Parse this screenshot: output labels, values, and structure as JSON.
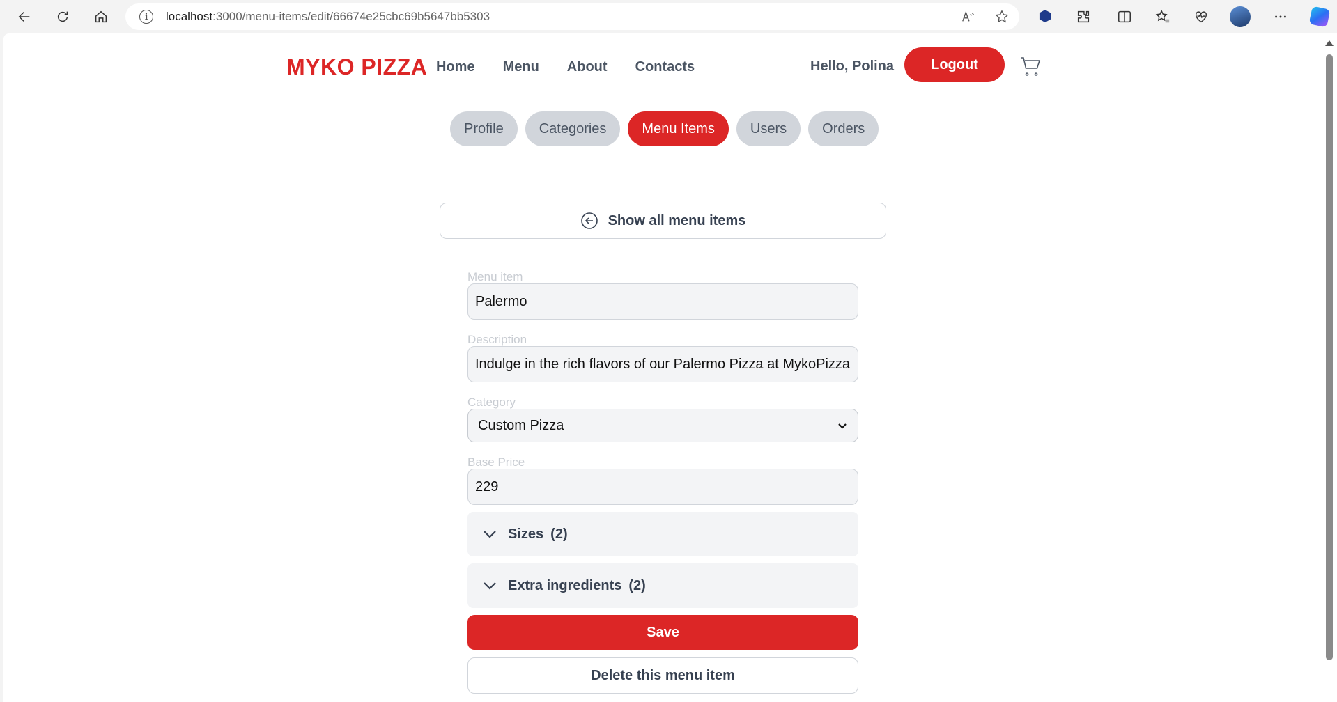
{
  "browser": {
    "url_host": "localhost",
    "url_path": ":3000/menu-items/edit/66674e25cbc69b5647bb5303",
    "icons": [
      "back-icon",
      "refresh-icon",
      "home-icon",
      "info-icon",
      "read-aloud-icon",
      "favorite-star-icon",
      "extension-icon",
      "puzzle-icon",
      "split-screen-icon",
      "favorites-icon",
      "browser-essentials-icon",
      "profile-avatar",
      "more-icon",
      "copilot-icon"
    ]
  },
  "header": {
    "logo": "MYKO PIZZA",
    "nav": [
      "Home",
      "Menu",
      "About",
      "Contacts"
    ],
    "greeting": "Hello, Polina",
    "logout": "Logout"
  },
  "tabs": [
    {
      "label": "Profile",
      "active": false
    },
    {
      "label": "Categories",
      "active": false
    },
    {
      "label": "Menu Items",
      "active": true
    },
    {
      "label": "Users",
      "active": false
    },
    {
      "label": "Orders",
      "active": false
    }
  ],
  "show_all": "Show all menu items",
  "form": {
    "name_label": "Menu item",
    "name_value": "Palermo",
    "description_label": "Description",
    "description_value": "Indulge in the rich flavors of our Palermo Pizza at MykoPizza",
    "category_label": "Category",
    "category_value": "Custom Pizza",
    "price_label": "Base Price",
    "price_value": "229",
    "sizes_label": "Sizes",
    "sizes_count": "(2)",
    "extras_label": "Extra ingredients",
    "extras_count": "(2)",
    "save": "Save",
    "delete": "Delete this menu item"
  },
  "colors": {
    "accent": "#dc2626",
    "tab_inactive": "#d1d5db",
    "text": "#4b5563"
  }
}
